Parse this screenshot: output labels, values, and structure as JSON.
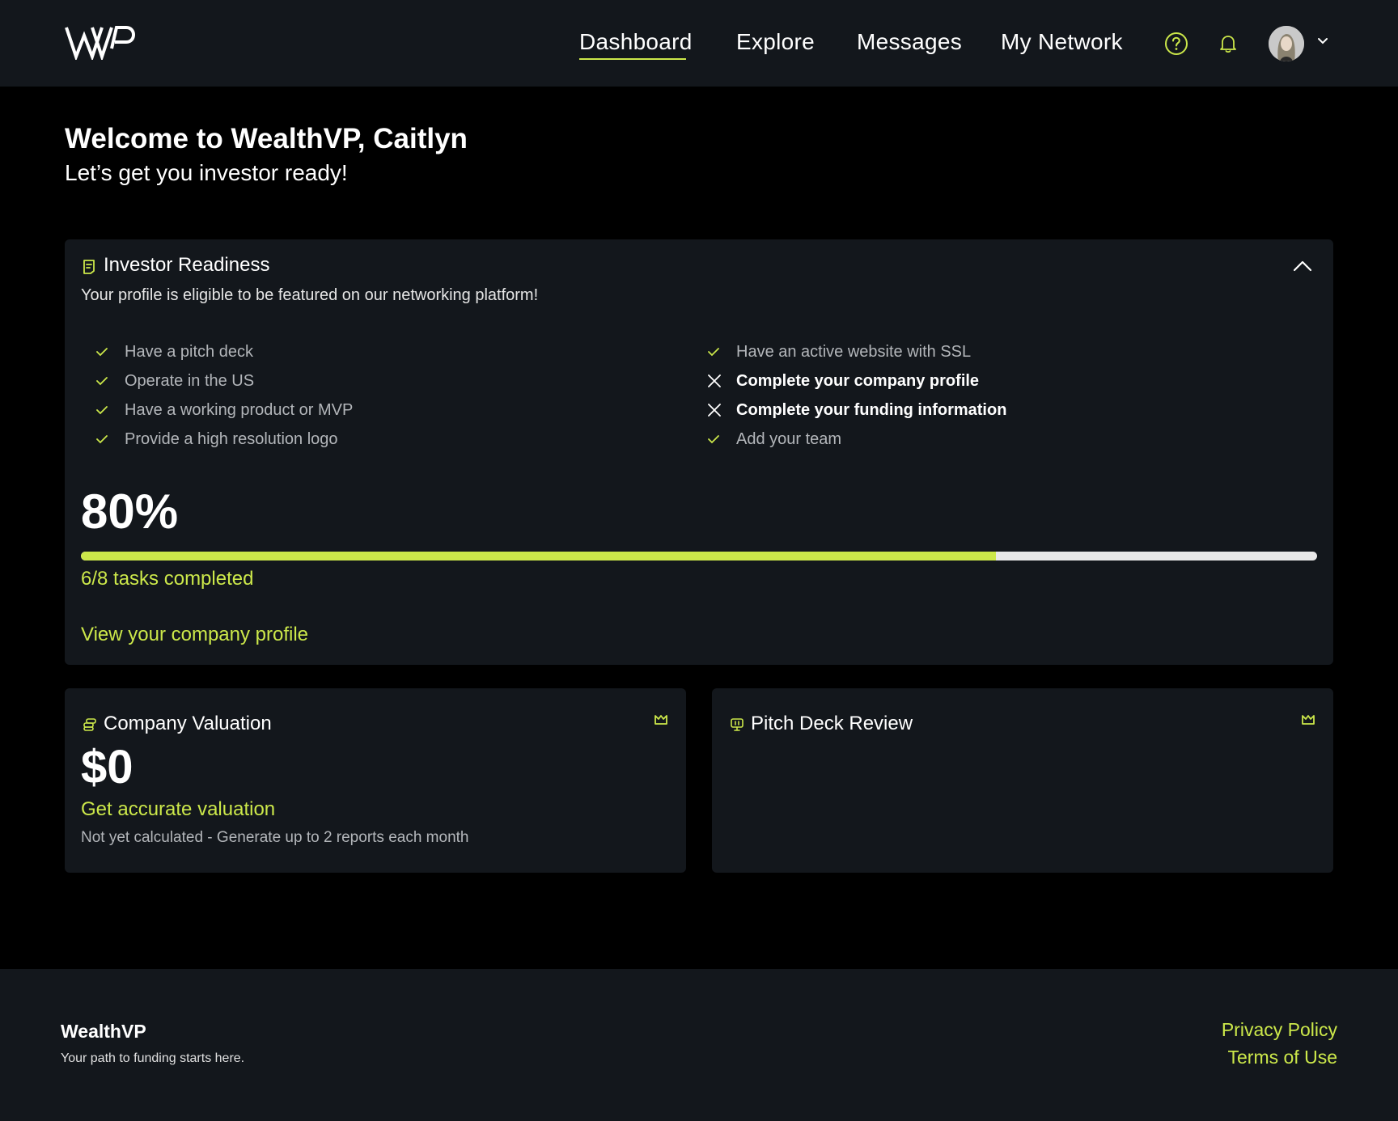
{
  "header": {
    "logo_text": "WVP",
    "nav": [
      {
        "label": "Dashboard",
        "active": true
      },
      {
        "label": "Explore",
        "active": false
      },
      {
        "label": "Messages",
        "active": false
      },
      {
        "label": "My Network",
        "active": false
      }
    ],
    "icons": [
      "help-circle-icon",
      "bell-icon",
      "avatar",
      "chevron-down-icon"
    ]
  },
  "welcome": {
    "title": "Welcome to WealthVP, Caitlyn",
    "subtitle": "Let’s get you investor ready!"
  },
  "readiness": {
    "title": "Investor Readiness",
    "description": "Your profile is eligible to be featured on our networking platform!",
    "checklist_left": [
      {
        "label": "Have a pitch deck",
        "done": true
      },
      {
        "label": "Operate in the US",
        "done": true
      },
      {
        "label": "Have a working product or MVP",
        "done": true
      },
      {
        "label": "Provide a high resolution logo",
        "done": true
      }
    ],
    "checklist_right": [
      {
        "label": "Have an active website with SSL",
        "done": true
      },
      {
        "label": "Complete your company profile",
        "done": false
      },
      {
        "label": "Complete your funding information",
        "done": false
      },
      {
        "label": "Add your team",
        "done": true
      }
    ],
    "percent_label": "80%",
    "progress_fraction": 0.74,
    "tasks_text": "6/8 tasks completed",
    "profile_link": "View your company profile"
  },
  "valuation": {
    "title": "Company Valuation",
    "amount": "$0",
    "link": "Get accurate valuation",
    "note": "Not yet calculated - Generate up to 2 reports each month"
  },
  "pitch": {
    "title": "Pitch Deck Review"
  },
  "footer": {
    "brand": "WealthVP",
    "tagline": "Your path to funding starts here.",
    "links": [
      "Privacy Policy",
      "Terms of Use"
    ]
  },
  "colors": {
    "accent": "#cce84a",
    "panel": "#13171c",
    "background": "#000000"
  }
}
